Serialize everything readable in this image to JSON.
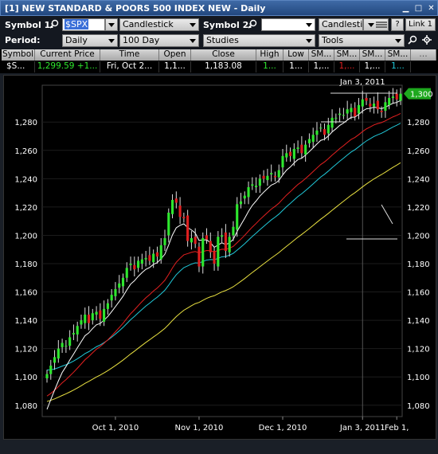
{
  "window": {
    "title": "[1] NEW STANDARD & POORS 500 INDEX NEW - Daily"
  },
  "toolbar": {
    "symbol1_label": "Symbol 1:",
    "symbol1_value": "$SPX",
    "chart_type": "Candlestick",
    "symbol2_label": "Symbol 2:",
    "symbol2_value": "",
    "chart_type2": "Candlestic",
    "help_label": "?",
    "link_label": "Link 1",
    "period_label": "Period:",
    "period_value": "Daily",
    "range_value": "100 Day",
    "studies_value": "Studies",
    "tools_value": "Tools"
  },
  "quote": {
    "headers": [
      "Symbol",
      "Current Price",
      "Time",
      "Open",
      "Close",
      "High",
      "Low",
      "SM...",
      "SM...",
      "SM...",
      "SM..."
    ],
    "symbol": "$S...",
    "price": "1,299.59",
    "change": "+1...",
    "time": "Fri, Oct 2...",
    "open": "1,1...",
    "close": "1,183.08",
    "high": "1...",
    "low": "1...",
    "sm1": "1,...",
    "sm2": "1,...",
    "sm3": "1,...",
    "sm4": "1..."
  },
  "chart_data": {
    "type": "candlestick",
    "crosshair_label": "Jan 3, 2011",
    "current_price_tag": "1,300",
    "xlabels": [
      "Oct 1, 2010",
      "Nov 1, 2010",
      "Dec 1, 2010",
      "Jan 3, 2011",
      "Feb 1,"
    ],
    "yticks": [
      1080,
      1100,
      1120,
      1140,
      1160,
      1180,
      1200,
      1220,
      1240,
      1260,
      1280
    ],
    "yticks_labels": [
      "1,080",
      "1,100",
      "1,120",
      "1,140",
      "1,160",
      "1,180",
      "1,200",
      "1,220",
      "1,240",
      "1,260",
      "1,280"
    ],
    "ylim": [
      1072,
      1306
    ],
    "colors": {
      "up": "#2ee82e",
      "down": "#e02020",
      "ma_short": "#ffffff",
      "ma_mid": "#e52020",
      "ma_long": "#e8e040",
      "ma_longest": "#20c8d8",
      "tag": "#1ea81e"
    },
    "closes": [
      1102,
      1108,
      1114,
      1120,
      1124,
      1122,
      1128,
      1131,
      1136,
      1140,
      1144,
      1138,
      1145,
      1146,
      1141,
      1148,
      1152,
      1158,
      1162,
      1166,
      1170,
      1177,
      1180,
      1176,
      1182,
      1183,
      1184,
      1182,
      1187,
      1185,
      1193,
      1198,
      1216,
      1225,
      1223,
      1213,
      1212,
      1196,
      1198,
      1194,
      1178,
      1198,
      1197,
      1188,
      1180,
      1199,
      1200,
      1189,
      1199,
      1206,
      1222,
      1224,
      1228,
      1234,
      1236,
      1235,
      1240,
      1240,
      1242,
      1244,
      1241,
      1246,
      1256,
      1258,
      1256,
      1261,
      1262,
      1258,
      1264,
      1268,
      1271,
      1274,
      1276,
      1271,
      1278,
      1283,
      1283,
      1286,
      1285,
      1289,
      1290,
      1284,
      1292,
      1296,
      1295,
      1291,
      1293,
      1289,
      1287,
      1294,
      1297,
      1298,
      1296,
      1300
    ]
  }
}
